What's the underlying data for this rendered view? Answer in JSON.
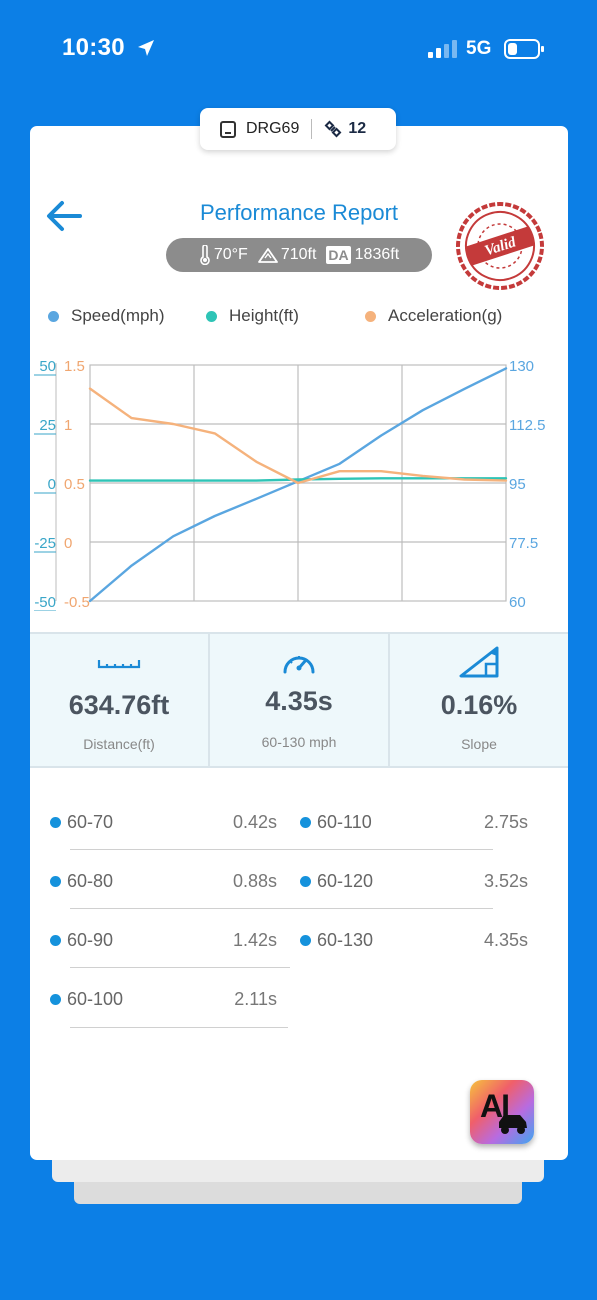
{
  "status_bar": {
    "time": "10:30",
    "network": "5G"
  },
  "device_chip": {
    "name": "DRG69",
    "satellites": "12"
  },
  "header": {
    "title": "Performance Report",
    "stamp_text": "Valid"
  },
  "conditions": {
    "temperature": "70°F",
    "altitude": "710ft",
    "da_label": "DA",
    "density_altitude": "1836ft"
  },
  "legend": [
    {
      "label": "Speed(mph)",
      "color": "#5aa6e0"
    },
    {
      "label": "Height(ft)",
      "color": "#2ec4b6"
    },
    {
      "label": "Acceleration(g)",
      "color": "#f5b27c"
    }
  ],
  "chart_data": {
    "type": "line",
    "x": [
      0,
      0.1,
      0.2,
      0.3,
      0.4,
      0.5,
      0.6,
      0.7,
      0.8,
      0.9,
      1.0
    ],
    "axes": {
      "height_ticks": [
        "50",
        "25",
        "0",
        "-25",
        "-50"
      ],
      "height_range": [
        -50,
        50
      ],
      "accel_ticks": [
        "1.5",
        "1",
        "0.5",
        "0",
        "-0.5"
      ],
      "accel_range": [
        -0.5,
        1.5
      ],
      "speed_ticks": [
        "130",
        "112.5",
        "95",
        "77.5",
        "60"
      ],
      "speed_range": [
        60,
        130
      ]
    },
    "series": [
      {
        "name": "Speed(mph)",
        "color": "#5aa6e0",
        "axis": "speed",
        "values": [
          60,
          70.5,
          79.2,
          85.2,
          90.3,
          95.5,
          100.7,
          109.1,
          116.6,
          122.9,
          129.0
        ]
      },
      {
        "name": "Height(ft)",
        "color": "#2ec4b6",
        "axis": "height",
        "values": [
          1,
          1,
          1,
          1,
          1,
          1.5,
          1.8,
          2,
          2,
          2,
          2
        ]
      },
      {
        "name": "Acceleration(g)",
        "color": "#f5b27c",
        "axis": "accel",
        "values": [
          1.3,
          1.05,
          1.0,
          0.92,
          0.68,
          0.5,
          0.6,
          0.6,
          0.56,
          0.53,
          0.52
        ]
      }
    ],
    "grid": true
  },
  "stats": [
    {
      "value": "634.76ft",
      "label": "Distance(ft)",
      "icon": "ruler-icon"
    },
    {
      "value": "4.35s",
      "label": "60-130 mph",
      "icon": "speedometer-icon"
    },
    {
      "value": "0.16%",
      "label": "Slope",
      "icon": "slope-icon"
    }
  ],
  "splits": [
    {
      "range": "60-70",
      "time": "0.42s"
    },
    {
      "range": "60-80",
      "time": "0.88s"
    },
    {
      "range": "60-90",
      "time": "1.42s"
    },
    {
      "range": "60-100",
      "time": "2.11s"
    },
    {
      "range": "60-110",
      "time": "2.75s"
    },
    {
      "range": "60-120",
      "time": "3.52s"
    },
    {
      "range": "60-130",
      "time": "4.35s"
    }
  ],
  "ai_button": {
    "label": "AI"
  }
}
